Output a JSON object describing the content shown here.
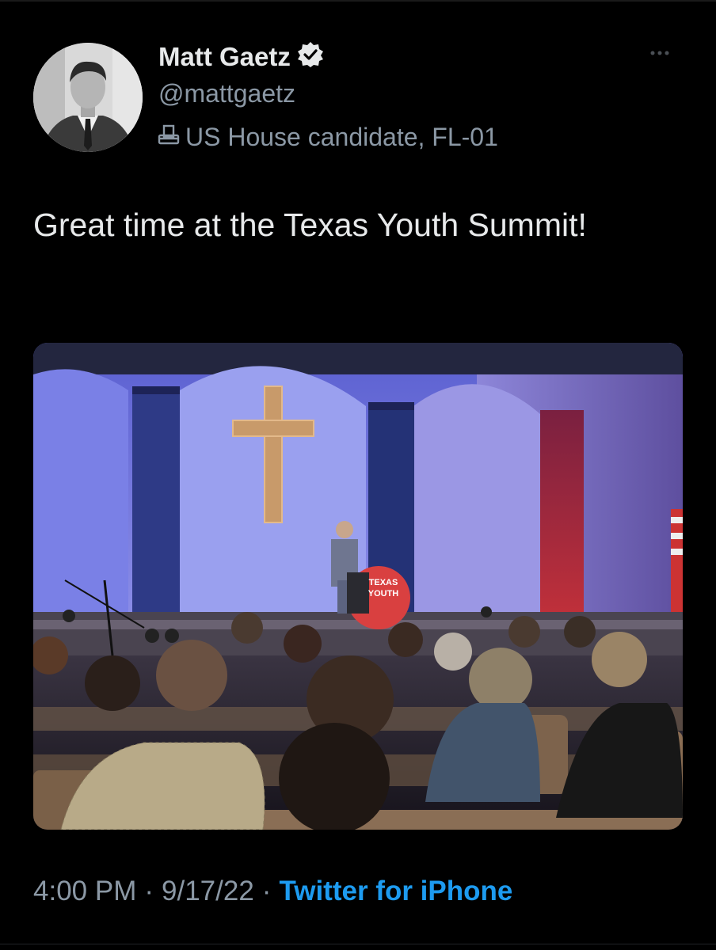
{
  "tweet": {
    "author": {
      "display_name": "Matt Gaetz",
      "handle": "@mattgaetz",
      "verified": true,
      "label": "US House candidate, FL-01",
      "label_icon": "ballot-box-icon"
    },
    "text": "Great time at the Texas Youth Summit!",
    "more_icon": "more-horizontal-icon",
    "media": {
      "podium_text": [
        "TEXAS",
        "YOUTH"
      ]
    },
    "time": "4:00 PM",
    "date": "9/17/22",
    "separator": "·",
    "source": "Twitter for iPhone"
  },
  "colors": {
    "background": "#000000",
    "primary_text": "#e7e9ea",
    "secondary_text": "#8b98a5",
    "link": "#1d9bf0"
  }
}
